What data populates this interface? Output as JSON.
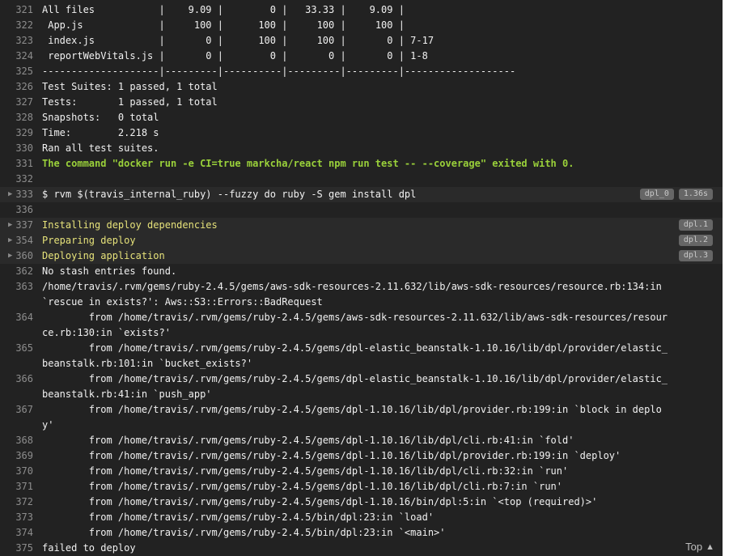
{
  "log": {
    "lines": [
      {
        "n": "321",
        "t": "All files           |    9.09 |        0 |   33.33 |    9.09 |"
      },
      {
        "n": "322",
        "t": " App.js             |     100 |      100 |     100 |     100 |"
      },
      {
        "n": "323",
        "t": " index.js           |       0 |      100 |     100 |       0 | 7-17"
      },
      {
        "n": "324",
        "t": " reportWebVitals.js |       0 |        0 |       0 |       0 | 1-8"
      },
      {
        "n": "325",
        "t": "--------------------|---------|----------|---------|---------|-------------------"
      },
      {
        "n": "326",
        "t": "Test Suites: 1 passed, 1 total"
      },
      {
        "n": "327",
        "t": "Tests:       1 passed, 1 total"
      },
      {
        "n": "328",
        "t": "Snapshots:   0 total"
      },
      {
        "n": "329",
        "t": "Time:        2.218 s"
      },
      {
        "n": "330",
        "t": "Ran all test suites."
      },
      {
        "n": "331",
        "t": "The command \"docker run -e CI=true markcha/react npm run test -- --coverage\" exited with 0."
      },
      {
        "n": "332",
        "t": ""
      },
      {
        "n": "333",
        "t": "$ rvm $(travis_internal_ruby) --fuzzy do ruby -S gem install dpl"
      },
      {
        "n": "336",
        "t": ""
      },
      {
        "n": "337",
        "t": "Installing deploy dependencies"
      },
      {
        "n": "354",
        "t": "Preparing deploy"
      },
      {
        "n": "360",
        "t": "Deploying application"
      },
      {
        "n": "362",
        "t": "No stash entries found."
      },
      {
        "n": "363",
        "t": "/home/travis/.rvm/gems/ruby-2.4.5/gems/aws-sdk-resources-2.11.632/lib/aws-sdk-resources/resource.rb:134:in `rescue in exists?': Aws::S3::Errors::BadRequest"
      },
      {
        "n": "364",
        "t": "        from /home/travis/.rvm/gems/ruby-2.4.5/gems/aws-sdk-resources-2.11.632/lib/aws-sdk-resources/resource.rb:130:in `exists?'"
      },
      {
        "n": "365",
        "t": "        from /home/travis/.rvm/gems/ruby-2.4.5/gems/dpl-elastic_beanstalk-1.10.16/lib/dpl/provider/elastic_beanstalk.rb:101:in `bucket_exists?'"
      },
      {
        "n": "366",
        "t": "        from /home/travis/.rvm/gems/ruby-2.4.5/gems/dpl-elastic_beanstalk-1.10.16/lib/dpl/provider/elastic_beanstalk.rb:41:in `push_app'"
      },
      {
        "n": "367",
        "t": "        from /home/travis/.rvm/gems/ruby-2.4.5/gems/dpl-1.10.16/lib/dpl/provider.rb:199:in `block in deploy'"
      },
      {
        "n": "368",
        "t": "        from /home/travis/.rvm/gems/ruby-2.4.5/gems/dpl-1.10.16/lib/dpl/cli.rb:41:in `fold'"
      },
      {
        "n": "369",
        "t": "        from /home/travis/.rvm/gems/ruby-2.4.5/gems/dpl-1.10.16/lib/dpl/provider.rb:199:in `deploy'"
      },
      {
        "n": "370",
        "t": "        from /home/travis/.rvm/gems/ruby-2.4.5/gems/dpl-1.10.16/lib/dpl/cli.rb:32:in `run'"
      },
      {
        "n": "371",
        "t": "        from /home/travis/.rvm/gems/ruby-2.4.5/gems/dpl-1.10.16/lib/dpl/cli.rb:7:in `run'"
      },
      {
        "n": "372",
        "t": "        from /home/travis/.rvm/gems/ruby-2.4.5/gems/dpl-1.10.16/bin/dpl:5:in `<top (required)>'"
      },
      {
        "n": "373",
        "t": "        from /home/travis/.rvm/gems/ruby-2.4.5/bin/dpl:23:in `load'"
      },
      {
        "n": "374",
        "t": "        from /home/travis/.rvm/gems/ruby-2.4.5/bin/dpl:23:in `<main>'"
      },
      {
        "n": "375",
        "t": "failed to deploy"
      }
    ],
    "fold_333": {
      "badge": "dpl_0",
      "time": "1.36s"
    },
    "fold_337": {
      "badge": "dpl.1"
    },
    "fold_354": {
      "badge": "dpl.2"
    },
    "fold_360": {
      "badge": "dpl.3"
    }
  },
  "footer": {
    "top_label": "Top"
  },
  "icons": {
    "fold": "caret-right-icon",
    "top": "arrow-up-icon"
  },
  "colors": {
    "background": "#222222",
    "success": "#9ad13a",
    "fold_title": "#e6e27a",
    "badge": "#666666"
  }
}
